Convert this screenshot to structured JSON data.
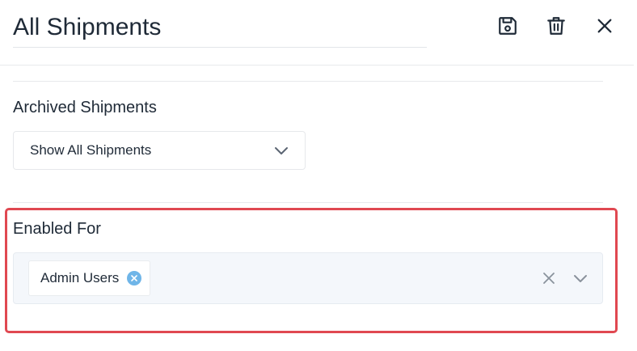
{
  "header": {
    "title": "All Shipments",
    "actions": [
      {
        "name": "save",
        "icon": "save-icon"
      },
      {
        "name": "delete",
        "icon": "trash-icon"
      },
      {
        "name": "close",
        "icon": "close-icon"
      }
    ]
  },
  "archived": {
    "label": "Archived Shipments",
    "selected_value": "Show All Shipments",
    "icon": "chevron-down-icon"
  },
  "enabled_for": {
    "label": "Enabled For",
    "chips": [
      {
        "label": "Admin Users",
        "remove_icon": "remove-chip-icon"
      }
    ],
    "clear_icon": "clear-icon",
    "dropdown_icon": "chevron-down-icon"
  },
  "colors": {
    "highlight_border": "#e04851",
    "chip_remove": "#6fb5e8",
    "multi_bg": "#f4f7fb"
  }
}
